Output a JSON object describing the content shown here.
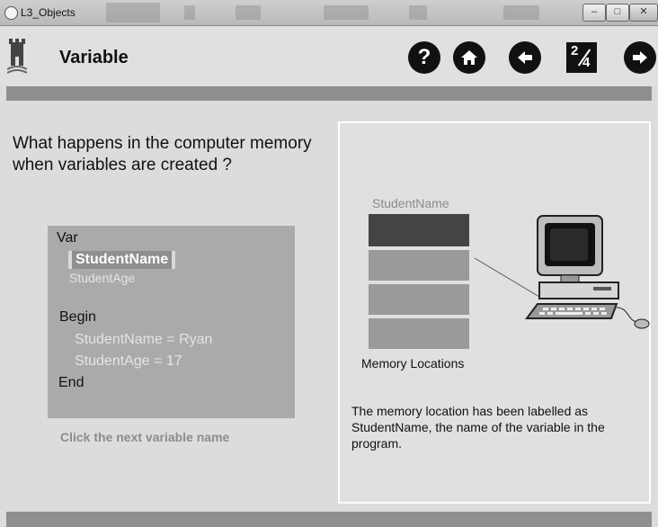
{
  "window": {
    "title": "L3_Objects"
  },
  "header": {
    "title": "Variable",
    "nav": {
      "help": "?",
      "page_current": "2",
      "page_total": "4"
    }
  },
  "lesson": {
    "question": "What happens in the computer memory when variables are created ?",
    "code": {
      "var_keyword": "Var",
      "var1": "StudentName",
      "var2": "StudentAge",
      "begin_keyword": "Begin",
      "stmt1": "StudentName = Ryan",
      "stmt2": "StudentAge = 17",
      "end_keyword": "End"
    },
    "hint": "Click the next variable name"
  },
  "memory": {
    "cell_label": "StudentName",
    "caption": "Memory Locations",
    "description": "The memory location has been labelled as StudentName, the name of the variable in the program."
  },
  "colors": {
    "accent_bar": "#8f8f8f",
    "cell": "#9a9a9a",
    "cell_active": "#444444"
  }
}
